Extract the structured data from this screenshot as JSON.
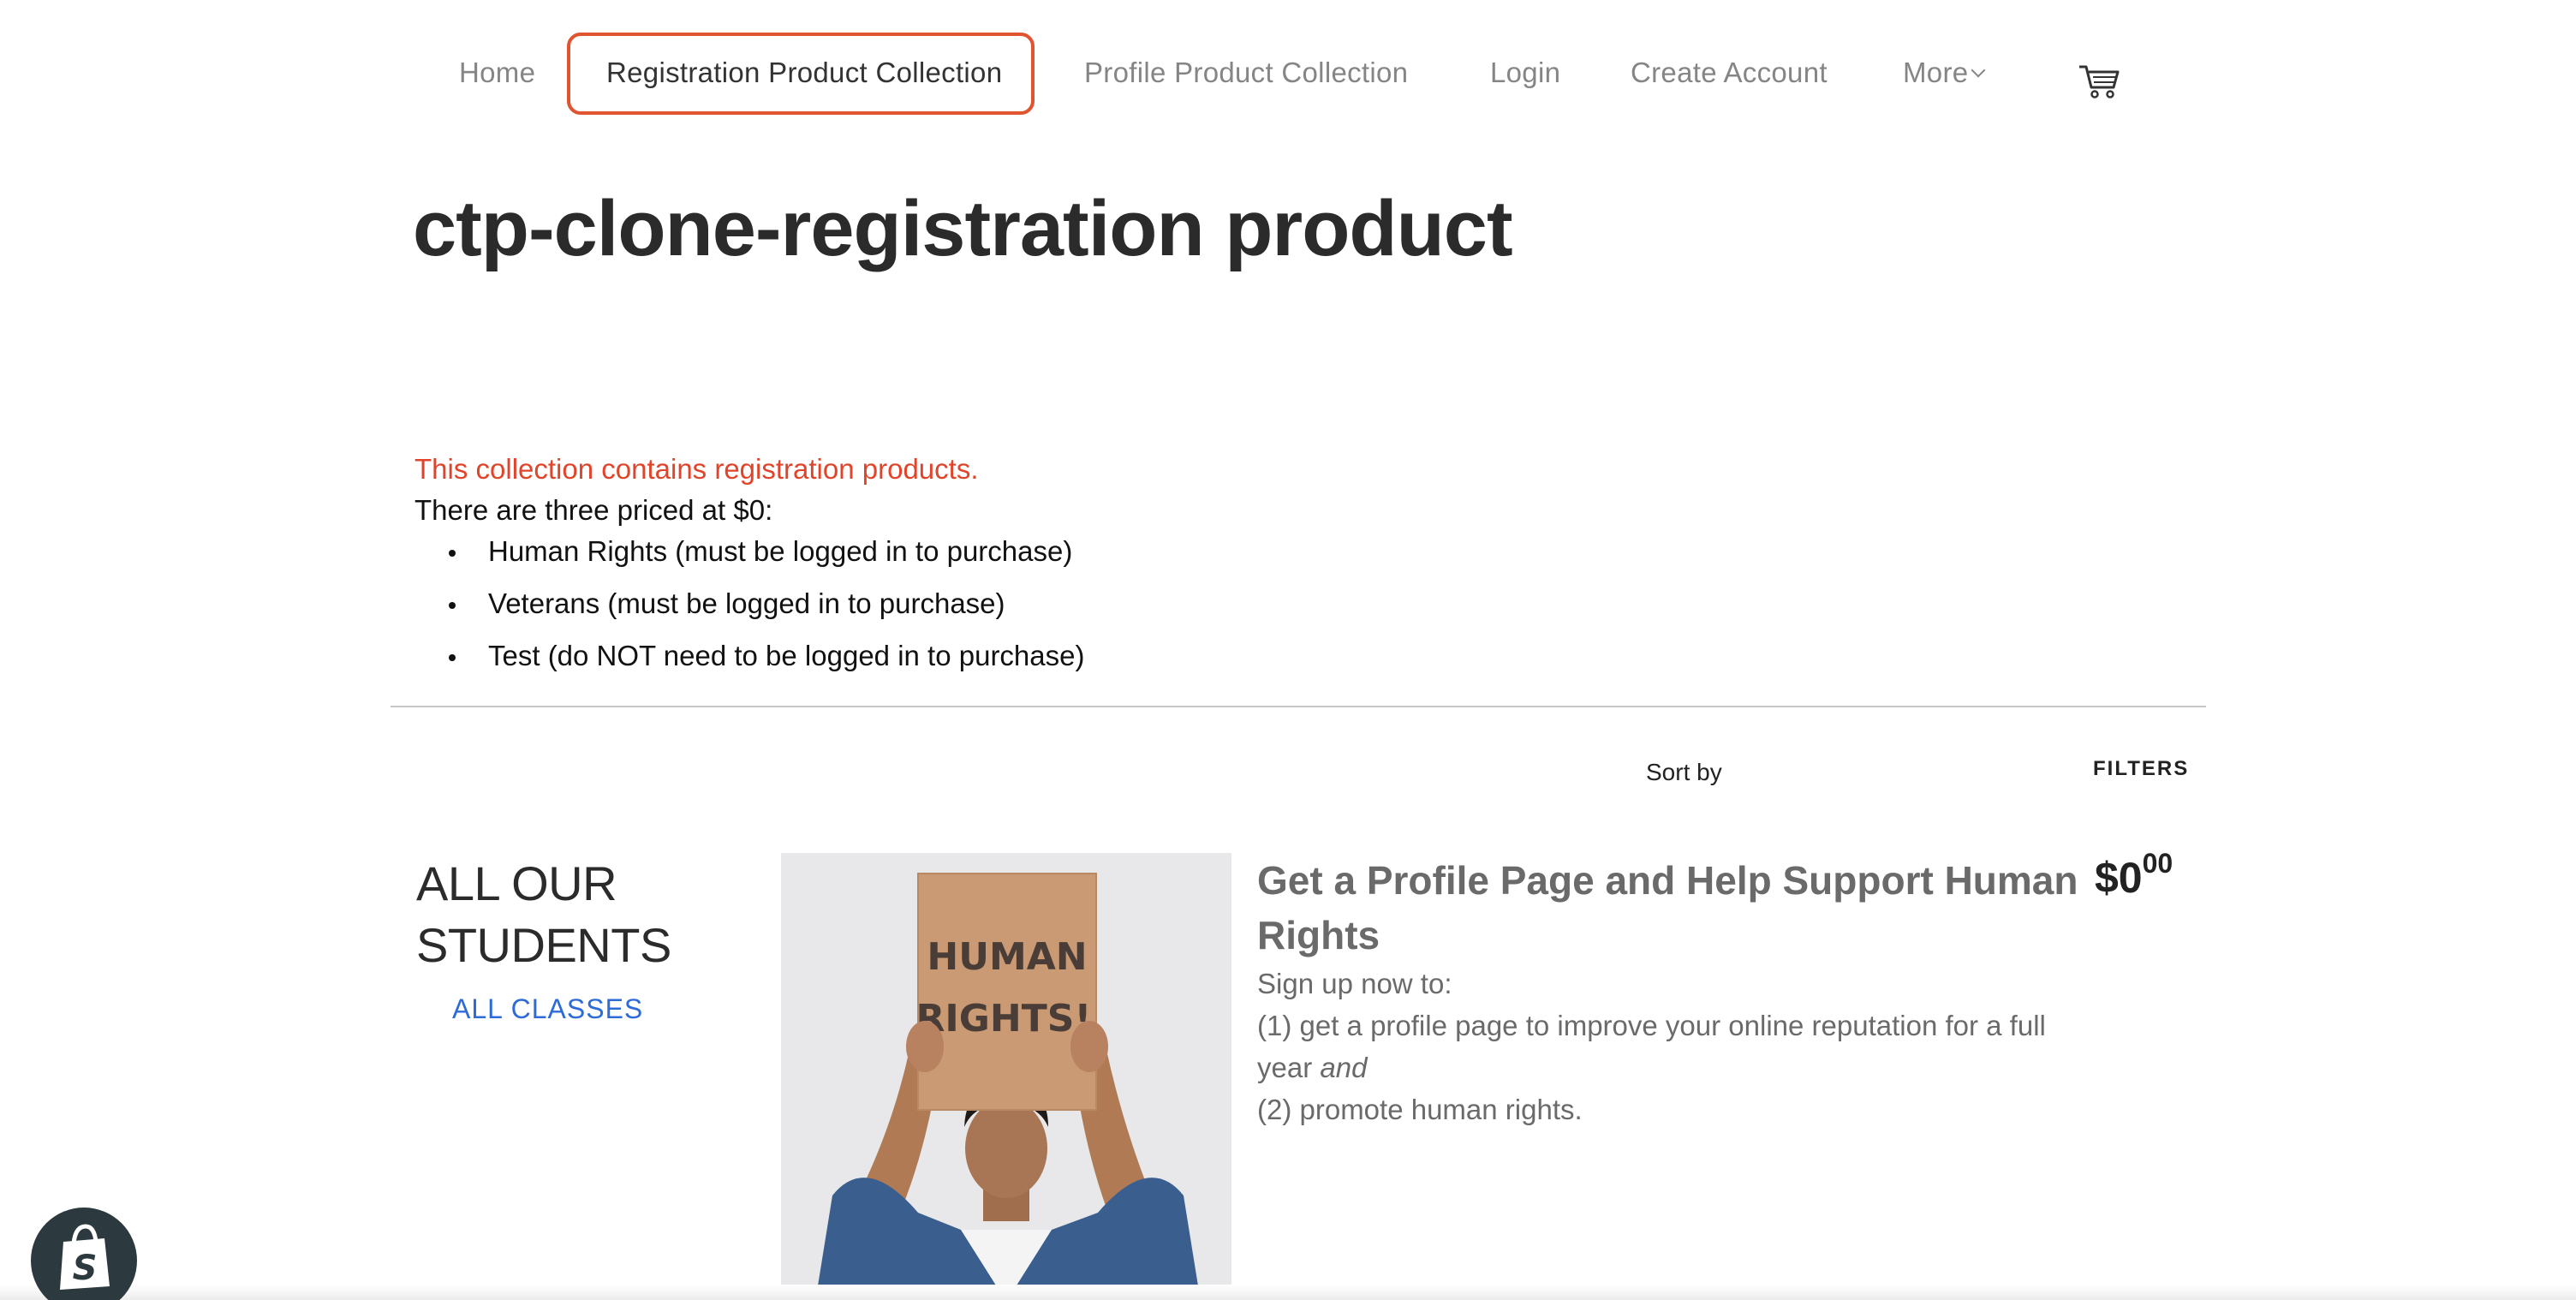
{
  "nav": {
    "items": [
      {
        "label": "Home"
      },
      {
        "label": "Registration Product Collection"
      },
      {
        "label": "Profile Product Collection"
      },
      {
        "label": "Login"
      },
      {
        "label": "Create Account"
      },
      {
        "label": "More"
      }
    ],
    "active_index": 1,
    "cart_icon": "cart-icon",
    "highlight_color": "#e0542f"
  },
  "page": {
    "title": "ctp-clone-registration product"
  },
  "description": {
    "intro_red": "This collection contains registration products.",
    "intro": "There are three priced at $0:",
    "items": [
      "Human Rights  (must be logged in to purchase)",
      "Veterans  (must be logged in to purchase)",
      "Test  (do NOT need to be logged in to purchase)"
    ],
    "red_color": "#e0452b"
  },
  "toolbar": {
    "sort_label": "Sort by",
    "filters_label": "FILTERS"
  },
  "sidebar": {
    "title_line1": "ALL OUR",
    "title_line2": "STUDENTS",
    "link": "ALL CLASSES",
    "link_color": "#2e6bd8"
  },
  "product": {
    "title": "Get a Profile Page and Help Support Human Rights",
    "price_main": "$0",
    "price_cents": "00",
    "body_line1": "Sign up now to:",
    "body_line2": "(1) get a profile page to improve your online reputation for a full year",
    "body_line2_em": "and",
    "body_line3": "(2) promote human rights.",
    "image_sign_line1": "HUMAN",
    "image_sign_line2": "RIGHTS!"
  },
  "badge": {
    "icon": "shopify-bag-icon",
    "letter": "S"
  }
}
